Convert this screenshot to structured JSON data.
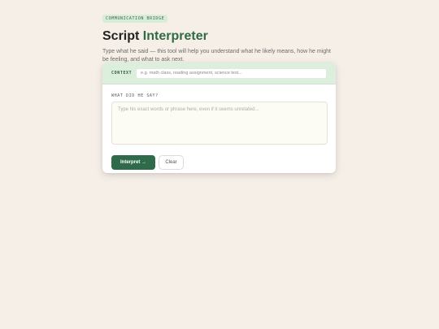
{
  "header": {
    "badge": "COMMUNICATION BRIDGE",
    "title_plain": "Script ",
    "title_accent": "Interpreter",
    "subtitle": "Type what he said — this tool will help you understand what he likely means, how he might be feeling, and what to ask next."
  },
  "context": {
    "label": "CONTEXT",
    "placeholder": "e.g. math class, reading assignment, science test..."
  },
  "question": {
    "label": "WHAT DID HE SAY?",
    "placeholder": "Type his exact words or phrase here, even if it seems unrelated..."
  },
  "actions": {
    "interpret_label": "Interpret →",
    "clear_label": "Clear"
  },
  "colors": {
    "background": "#f6efe8",
    "accent": "#2f6b46",
    "primary_button": "#2f6b4a",
    "context_bar": "#dcefdc"
  }
}
